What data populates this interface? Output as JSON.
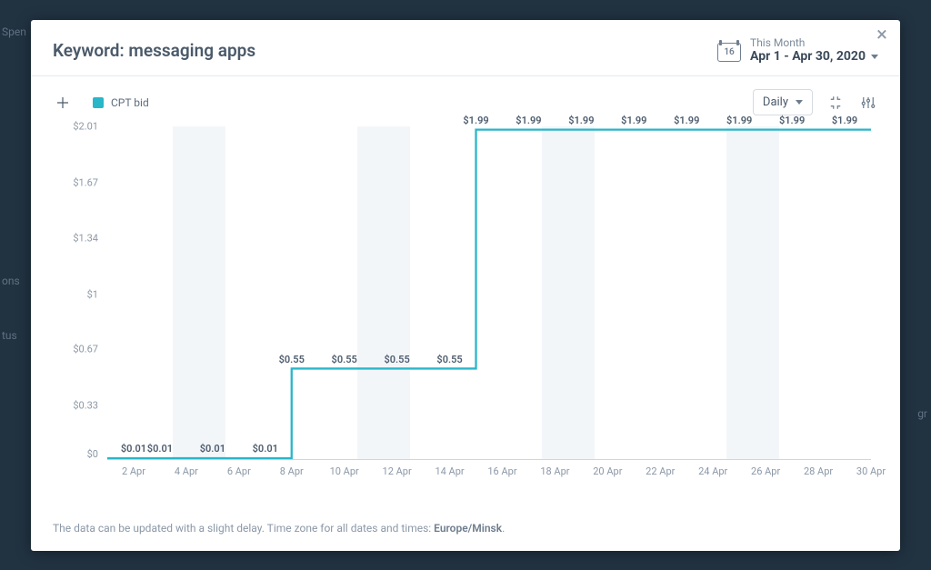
{
  "header": {
    "title": "Keyword: messaging apps",
    "calendar_day": "16",
    "date_label": "This Month",
    "date_range": "Apr 1 - Apr 30, 2020"
  },
  "toolbar": {
    "legend_label": "CPT bid",
    "aggregation": "Daily"
  },
  "footer": {
    "note_prefix": "The data can be updated with a slight delay. Time zone for all dates and times: ",
    "timezone": "Europe/Minsk",
    "suffix": "."
  },
  "chart_data": {
    "type": "line",
    "title": "",
    "xlabel": "",
    "ylabel": "",
    "ylim": [
      0,
      2.01
    ],
    "y_ticks": [
      0,
      0.33,
      0.67,
      1,
      1.34,
      1.67,
      2.01
    ],
    "y_tick_labels": [
      "$0",
      "$0.33",
      "$0.67",
      "$1",
      "$1.34",
      "$1.67",
      "$2.01"
    ],
    "x_tick_labels": [
      "2 Apr",
      "4 Apr",
      "6 Apr",
      "8 Apr",
      "10 Apr",
      "12 Apr",
      "14 Apr",
      "16 Apr",
      "18 Apr",
      "20 Apr",
      "22 Apr",
      "24 Apr",
      "26 Apr",
      "28 Apr",
      "30 Apr"
    ],
    "x_tick_positions_days": [
      2,
      4,
      6,
      8,
      10,
      12,
      14,
      16,
      18,
      20,
      22,
      24,
      26,
      28,
      30
    ],
    "x_domain_days": [
      1,
      30
    ],
    "weekend_bands_days": [
      [
        4,
        5
      ],
      [
        11,
        12
      ],
      [
        18,
        19
      ],
      [
        25,
        26
      ]
    ],
    "series": [
      {
        "name": "CPT bid",
        "color": "#29b6c9",
        "x": [
          1,
          2,
          3,
          4,
          5,
          6,
          7,
          8,
          9,
          10,
          11,
          12,
          13,
          14,
          15,
          16,
          17,
          18,
          19,
          20,
          21,
          22,
          23,
          24,
          25,
          26,
          27,
          28,
          29,
          30
        ],
        "y": [
          0.01,
          0.01,
          0.01,
          0.01,
          0.01,
          0.01,
          0.01,
          0.55,
          0.55,
          0.55,
          0.55,
          0.55,
          0.55,
          0.55,
          1.99,
          1.99,
          1.99,
          1.99,
          1.99,
          1.99,
          1.99,
          1.99,
          1.99,
          1.99,
          1.99,
          1.99,
          1.99,
          1.99,
          1.99,
          1.99
        ]
      }
    ],
    "data_labels": [
      {
        "x": 2,
        "y": 0.01,
        "text": "$0.01"
      },
      {
        "x": 3,
        "y": 0.01,
        "text": "$0.01"
      },
      {
        "x": 5,
        "y": 0.01,
        "text": "$0.01"
      },
      {
        "x": 7,
        "y": 0.01,
        "text": "$0.01"
      },
      {
        "x": 8,
        "y": 0.55,
        "text": "$0.55"
      },
      {
        "x": 10,
        "y": 0.55,
        "text": "$0.55"
      },
      {
        "x": 12,
        "y": 0.55,
        "text": "$0.55"
      },
      {
        "x": 14,
        "y": 0.55,
        "text": "$0.55"
      },
      {
        "x": 15,
        "y": 1.99,
        "text": "$1.99"
      },
      {
        "x": 17,
        "y": 1.99,
        "text": "$1.99"
      },
      {
        "x": 19,
        "y": 1.99,
        "text": "$1.99"
      },
      {
        "x": 21,
        "y": 1.99,
        "text": "$1.99"
      },
      {
        "x": 23,
        "y": 1.99,
        "text": "$1.99"
      },
      {
        "x": 25,
        "y": 1.99,
        "text": "$1.99"
      },
      {
        "x": 27,
        "y": 1.99,
        "text": "$1.99"
      },
      {
        "x": 29,
        "y": 1.99,
        "text": "$1.99"
      }
    ]
  },
  "bg_fragments": {
    "spen": "Spen",
    "ons": "ons",
    "tus": "tus",
    "gr": "gr"
  }
}
